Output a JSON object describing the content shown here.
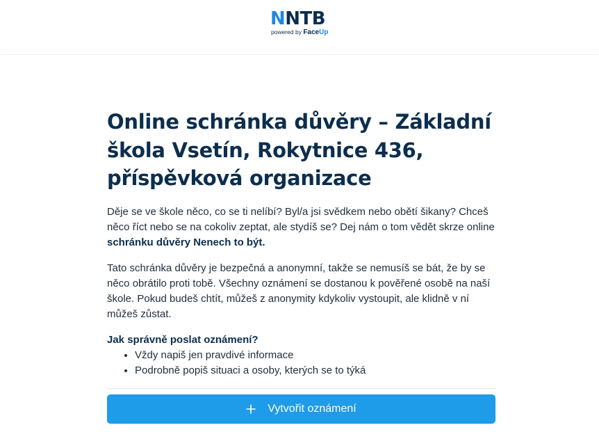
{
  "header": {
    "logo_first_letter": "N",
    "logo_rest": "NTB",
    "logo_powered_by": "powered by",
    "logo_brand_prefix": "Face",
    "logo_brand_suffix": "Up"
  },
  "main": {
    "title": "Online schránka důvěry – Základní škola Vsetín, Rokytnice 436, příspěvková organizace",
    "intro_part1": "Děje se ve škole něco, co se ti nelíbí? Byl/a jsi svědkem nebo obětí šikany? Chceš něco říct nebo se na cokoliv zeptat, ale stydíš se? Dej nám o tom vědět skrze online ",
    "intro_bold": "schránku důvěry Nenech to být.",
    "paragraph2": "Tato schránka důvěry je bezpečná a anonymní, takže se nemusíš se bát, že by se něco obrátilo proti tobě. Všechny oznámení se dostanou k pověřené osobě na naší škole. Pokud budeš chtít, můžeš z anonymity kdykoliv vystoupit, ale klidně v ní můžeš zůstat.",
    "how_heading": "Jak správně poslat oznámení?",
    "tips": [
      "Vždy napiš jen pravdivé informace",
      "Podrobně popiš situaci a osoby, kterých se to týká"
    ]
  },
  "actions": {
    "create_label": "Vytvořit oznámení",
    "create_icon": "plus-icon"
  },
  "colors": {
    "primary": "#1e9be9",
    "heading": "#0c2e4e",
    "logo_accent": "#1e88e5"
  }
}
